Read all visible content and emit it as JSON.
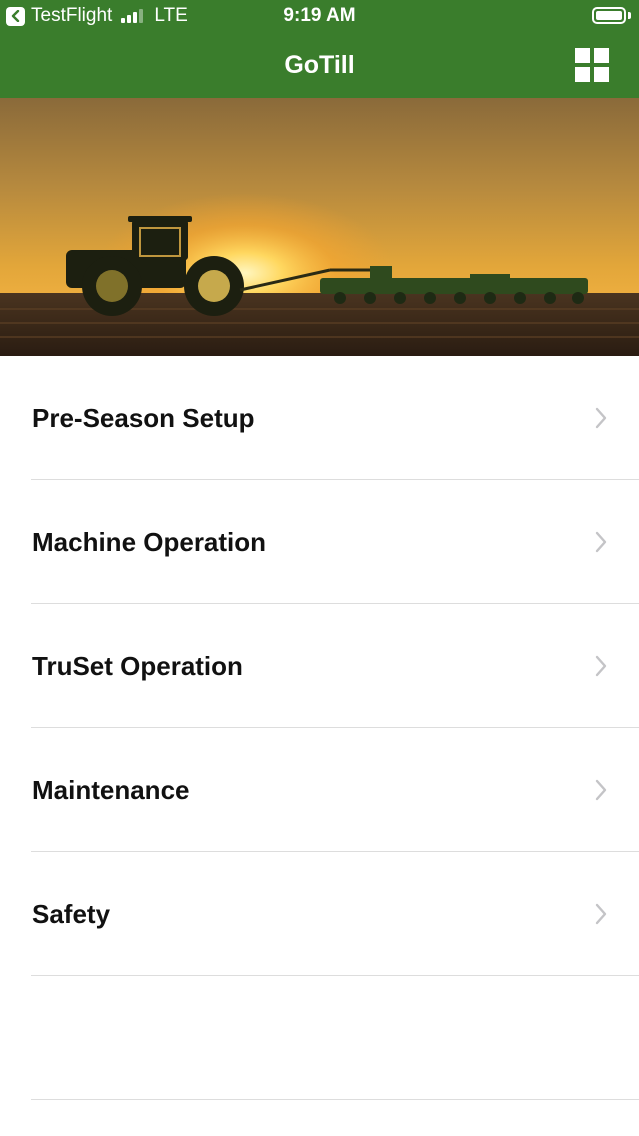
{
  "status_bar": {
    "carrier": "TestFlight",
    "network": "LTE",
    "time": "9:19 AM"
  },
  "header": {
    "title": "GoTill",
    "menu_icon": "grid-icon"
  },
  "hero": {
    "image": "tractor-sunset-photo"
  },
  "menu": {
    "items": [
      {
        "label": "Pre-Season Setup"
      },
      {
        "label": "Machine Operation"
      },
      {
        "label": "TruSet Operation"
      },
      {
        "label": "Maintenance"
      },
      {
        "label": "Safety"
      }
    ]
  },
  "colors": {
    "header_green": "#3a7d2c",
    "divider": "#dddddd",
    "chevron": "#c4c4c7"
  }
}
